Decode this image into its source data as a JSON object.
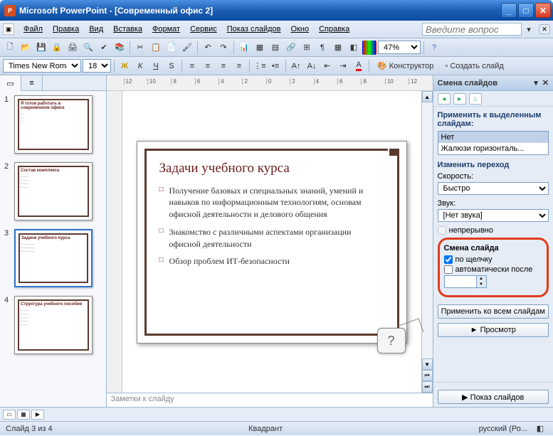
{
  "titlebar": {
    "app": "Microsoft PowerPoint",
    "doc": "[Современный офис 2]"
  },
  "menu": {
    "file": "Файл",
    "edit": "Правка",
    "view": "Вид",
    "insert": "Вставка",
    "format": "Формат",
    "tools": "Сервис",
    "slideshow": "Показ слайдов",
    "window": "Окно",
    "help": "Справка"
  },
  "question_placeholder": "Введите вопрос",
  "toolbar": {
    "zoom": "47%",
    "font": "Times New Roman",
    "size": "18",
    "designer": "Конструктор",
    "new_slide": "Создать слайд"
  },
  "ruler_ticks": [
    "12",
    "10",
    "8",
    "6",
    "4",
    "2",
    "0",
    "2",
    "4",
    "6",
    "8",
    "10",
    "12"
  ],
  "thumbs": [
    {
      "num": "1",
      "title": "Я готов работать в современном офисе"
    },
    {
      "num": "2",
      "title": "Состав комплекса"
    },
    {
      "num": "3",
      "title": "Задачи учебного курса"
    },
    {
      "num": "4",
      "title": "Структура учебного пособия"
    }
  ],
  "slide": {
    "title": "Задачи учебного курса",
    "bullets": [
      "Получение базовых и специальных знаний, умений и навыков по информационным технологиям, основам офисной деятельности и делового общения",
      "Знакомство с различными аспектами организации офисной деятельности",
      "Обзор проблем ИТ-безопасности"
    ]
  },
  "callout": "?",
  "notes_placeholder": "Заметки к слайду",
  "taskpane": {
    "title": "Смена слайдов",
    "apply_to_selected": "Применить к выделенным слайдам:",
    "transition_options": [
      "Нет",
      "Жалюзи горизонталь..."
    ],
    "modify_transition": "Изменить переход",
    "speed_label": "Скорость:",
    "speed_value": "Быстро",
    "sound_label": "Звук:",
    "sound_value": "[Нет звука]",
    "loop_label": "непрерывно",
    "advance_title": "Смена слайда",
    "on_click": "по щелчку",
    "auto_after": "автоматически после",
    "apply_all": "Применить ко всем слайдам",
    "preview": "Просмотр",
    "slideshow": "Показ слайдов"
  },
  "statusbar": {
    "slide": "Слайд 3 из 4",
    "layout": "Квадрант",
    "lang": "русский (Ро..."
  }
}
